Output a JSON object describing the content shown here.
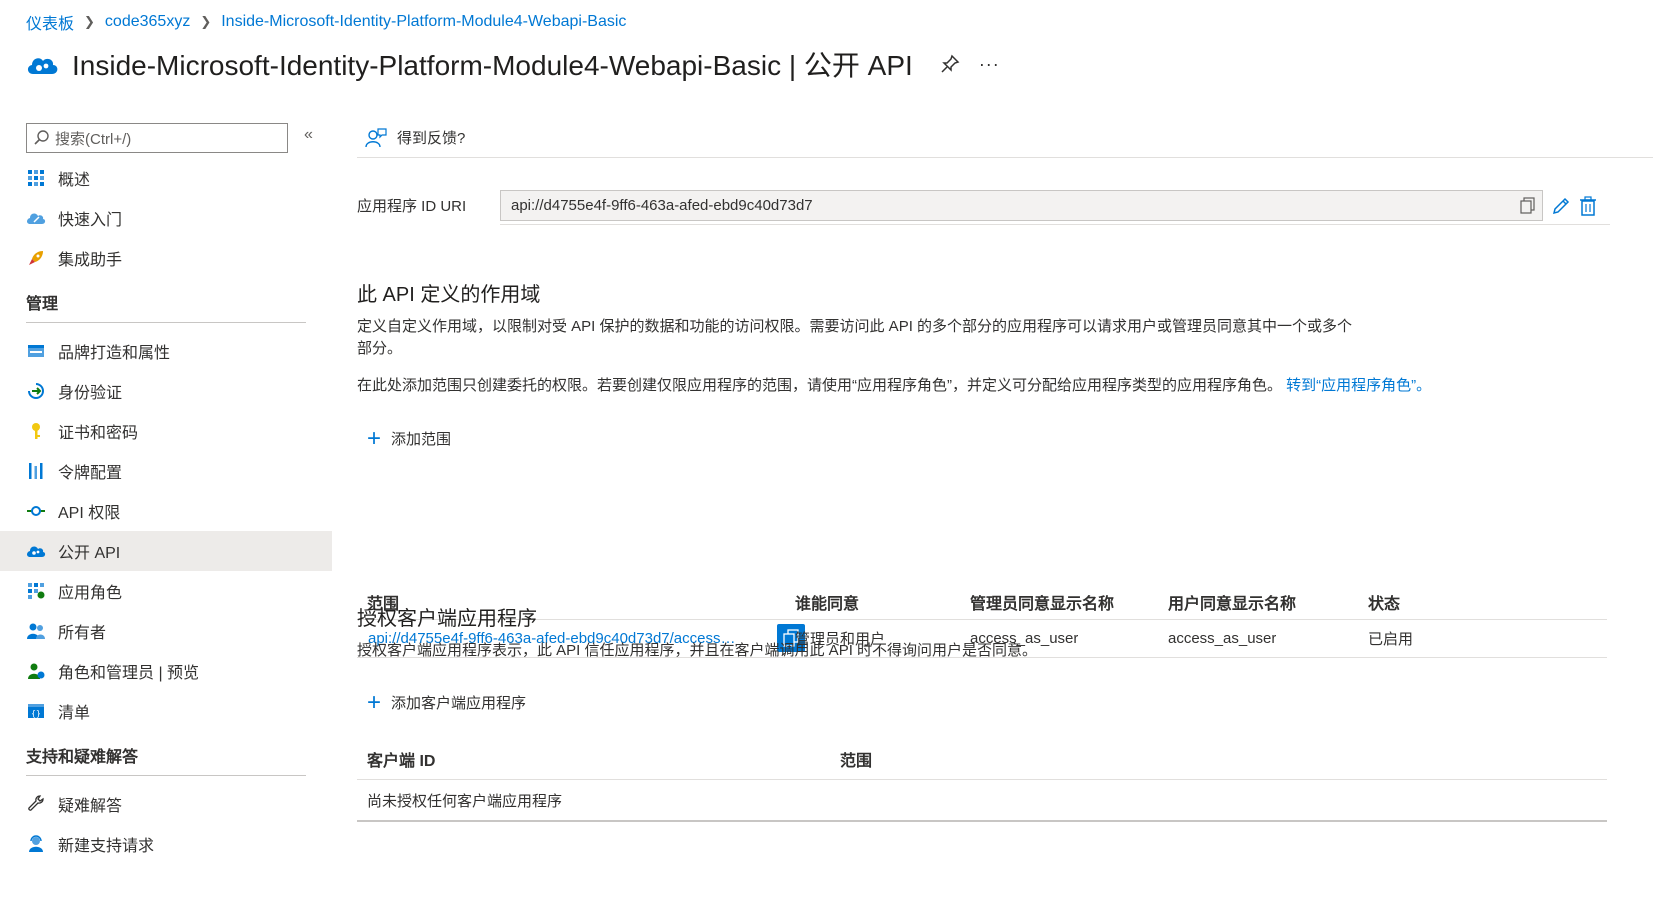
{
  "breadcrumb": {
    "items": [
      "仪表板",
      "code365xyz",
      "Inside-Microsoft-Identity-Platform-Module4-Webapi-Basic"
    ]
  },
  "header": {
    "title": "Inside-Microsoft-Identity-Platform-Module4-Webapi-Basic | 公开 API",
    "more": "···"
  },
  "sidebar": {
    "search_placeholder": "搜索(Ctrl+/)",
    "collapse": "«",
    "top_items": [
      {
        "label": "概述",
        "icon": "overview-grid-icon"
      },
      {
        "label": "快速入门",
        "icon": "cloud-quickstart-icon"
      },
      {
        "label": "集成助手",
        "icon": "rocket-icon"
      }
    ],
    "manage_title": "管理",
    "manage_items": [
      {
        "label": "品牌打造和属性",
        "icon": "branding-icon"
      },
      {
        "label": "身份验证",
        "icon": "authentication-icon"
      },
      {
        "label": "证书和密码",
        "icon": "key-icon"
      },
      {
        "label": "令牌配置",
        "icon": "token-bars-icon"
      },
      {
        "label": "API 权限",
        "icon": "api-permissions-icon"
      },
      {
        "label": "公开 API",
        "icon": "cloud-api-icon"
      },
      {
        "label": "应用角色",
        "icon": "app-roles-icon"
      },
      {
        "label": "所有者",
        "icon": "owners-icon"
      },
      {
        "label": "角色和管理员 | 预览",
        "icon": "roles-admins-icon"
      },
      {
        "label": "清单",
        "icon": "manifest-icon"
      }
    ],
    "support_title": "支持和疑难解答",
    "support_items": [
      {
        "label": "疑难解答",
        "icon": "wrench-icon"
      },
      {
        "label": "新建支持请求",
        "icon": "support-person-icon"
      }
    ]
  },
  "toolbar": {
    "feedback_label": "得到反馈?"
  },
  "uri": {
    "label": "应用程序 ID URI",
    "value": "api://d4755e4f-9ff6-463a-afed-ebd9c40d73d7"
  },
  "scopes": {
    "title": "此 API 定义的作用域",
    "desc1": "定义自定义作用域，以限制对受 API 保护的数据和功能的访问权限。需要访问此 API 的多个部分的应用程序可以请求用户或管理员同意其中一个或多个部分。",
    "desc2": "在此处添加范围只创建委托的权限。若要创建仅限应用程序的范围，请使用“应用程序角色”，并定义可分配给应用程序类型的应用程序角色。",
    "desc2_link": "转到“应用程序角色”。",
    "add_label": "添加范围",
    "columns": [
      "范围",
      "谁能同意",
      "管理员同意显示名称",
      "用户同意显示名称",
      "状态"
    ],
    "rows": [
      {
        "scope": "api://d4755e4f-9ff6-463a-afed-ebd9c40d73d7/access…",
        "who": "管理员和用户",
        "admin_name": "access_as_user",
        "user_name": "access_as_user",
        "state": "已启用"
      }
    ]
  },
  "clients": {
    "title": "授权客户端应用程序",
    "desc": "授权客户端应用程序表示，此 API 信任应用程序，并且在客户端调用此 API 时不得询问用户是否同意。",
    "add_label": "添加客户端应用程序",
    "columns": [
      "客户端 ID",
      "范围"
    ],
    "empty": "尚未授权任何客户端应用程序"
  },
  "colors": {
    "accent": "#0078d4",
    "active_bg": "#edebe9"
  }
}
